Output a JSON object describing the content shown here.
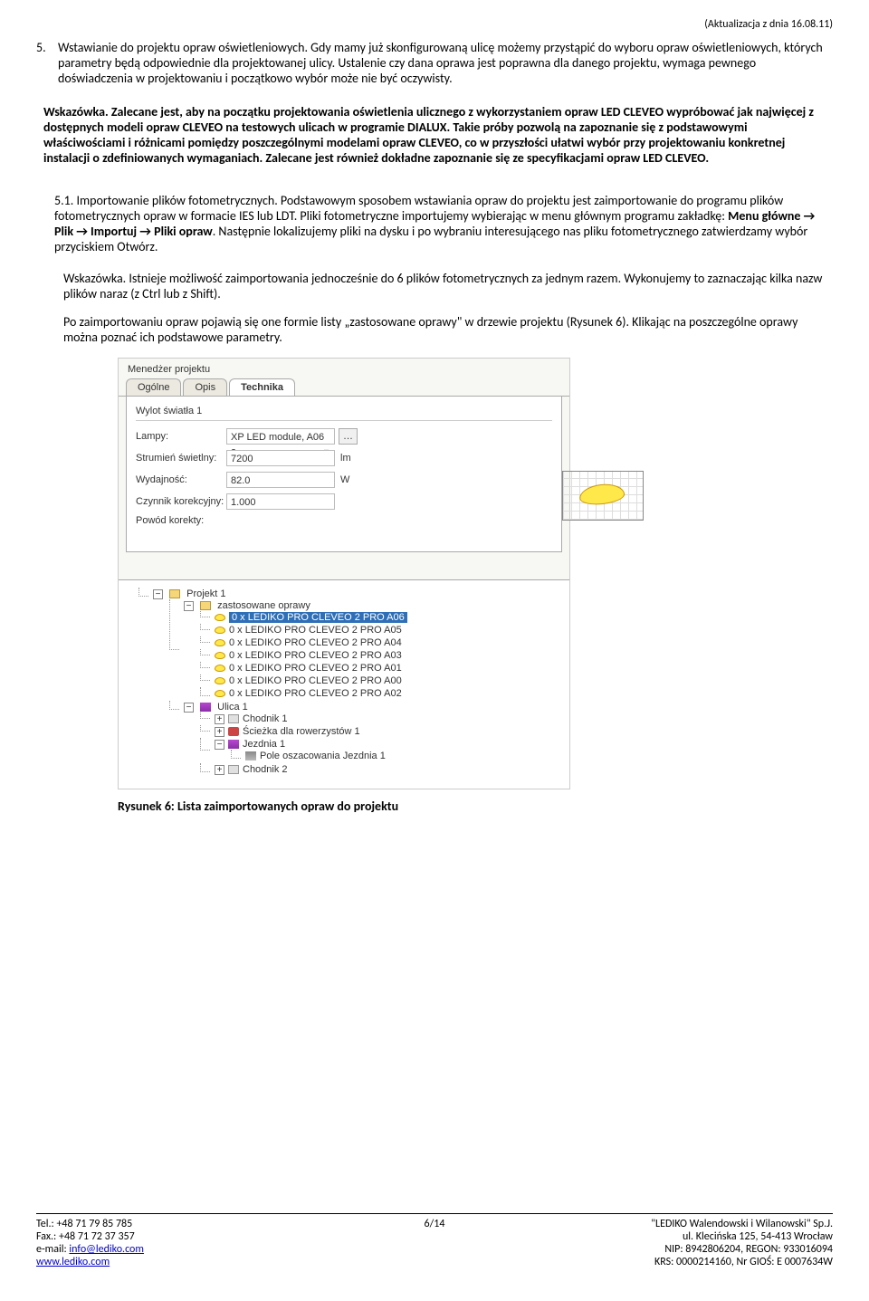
{
  "header_update": "(Aktualizacja z dnia  16.08.11)",
  "section5_num": "5.",
  "section5_text": "Wstawianie do projektu opraw oświetleniowych. Gdy mamy już skonfigurowaną ulicę możemy przystąpić do wyboru opraw oświetleniowych, których parametry będą odpowiednie dla projektowanej ulicy. Ustalenie czy dana oprawa jest poprawna dla danego projektu, wymaga pewnego doświadczenia w projektowaniu i początkowo wybór może nie być oczywisty.",
  "hint_text": "Wskazówka. Zalecane jest, aby na początku projektowania oświetlenia ulicznego z wykorzystaniem opraw LED CLEVEO wypróbować jak najwięcej z dostępnych modeli opraw CLEVEO na testowych ulicach w programie DIALUX. Takie próby pozwolą na zapoznanie się z podstawowymi właściwościami i różnicami pomiędzy poszczególnymi modelami opraw CLEVEO, co w przyszłości ułatwi wybór przy projektowaniu konkretnej instalacji o zdefiniowanych wymaganiach. Zalecane jest również dokładne zapoznanie się ze specyfikacjami opraw LED CLEVEO.",
  "sub51_num": "5.1.",
  "sub51_para1a": "Importowanie plików fotometrycznych. Podstawowym sposobem wstawiania opraw do projektu jest zaimportowanie do programu plików fotometrycznych opraw w formacie IES lub LDT. Pliki fotometryczne importujemy wybierając w menu głównym programu zakładkę: ",
  "sub51_menu": "Menu główne →  Plik → Importuj → Pliki opraw",
  "sub51_para1b": ". Następnie lokalizujemy pliki na dysku i po wybraniu interesującego nas pliku fotometrycznego zatwierdzamy wybór przyciskiem Otwórz.",
  "sub51_para2": "Wskazówka.  Istnieje możliwość zaimportowania jednocześnie do 6 plików fotometrycznych za jednym razem. Wykonujemy to zaznaczając kilka nazw plików naraz (z Ctrl lub z Shift).",
  "sub51_para3": "Po zaimportowaniu opraw pojawią się one formie listy „zastosowane oprawy\" w drzewie projektu (Rysunek 6). Klikając na poszczególne oprawy można poznać ich podstawowe parametry.",
  "screenshot": {
    "pm_title": "Menedżer projektu",
    "tabs": [
      "Ogólne",
      "Opis",
      "Technika"
    ],
    "active_tab": 2,
    "group_title": "Wylot światła 1",
    "rows": {
      "lamp_label": "Lampy:",
      "lamp_value": "XP LED module, A06 a",
      "flux_label": "Strumień świetlny:",
      "flux_value": "7200",
      "flux_unit": "lm",
      "power_label": "Wydajność:",
      "power_value": "82.0",
      "power_unit": "W",
      "factor_label": "Czynnik korekcyjny:",
      "factor_value": "1.000",
      "reason_label": "Powód korekty:"
    },
    "tree": {
      "root": "Projekt 1",
      "used": "zastosowane oprawy",
      "lamps": [
        "0 x LEDIKO PRO  CLEVEO 2 PRO A06",
        "0 x LEDIKO PRO  CLEVEO 2 PRO A05",
        "0 x LEDIKO PRO  CLEVEO 2 PRO A04",
        "0 x LEDIKO PRO  CLEVEO 2 PRO A03",
        "0 x LEDIKO PRO  CLEVEO 2 PRO A01",
        "0 x LEDIKO PRO  CLEVEO 2 PRO A00",
        "0 x LEDIKO PRO  CLEVEO 2 PRO A02"
      ],
      "selected_lamp": 0,
      "street": "Ulica 1",
      "sidewalk1": "Chodnik 1",
      "bikepath": "Ścieżka dla rowerzystów 1",
      "roadway": "Jezdnia 1",
      "pole": "Pole oszacowania Jezdnia 1",
      "sidewalk2": "Chodnik 2"
    }
  },
  "caption": "Rysunek 6: Lista zaimportowanych opraw do projektu",
  "footer": {
    "tel": "Tel.: +48 71 79 85 785",
    "fax": "Fax.: +48 71 72 37 357",
    "email_label": "e-mail: ",
    "email": "info@lediko.com",
    "web": "www.lediko.com",
    "page": "6/14",
    "company": "\"LEDIKO Walendowski i Wilanowski\" Sp.J.",
    "addr": "ul. Klecińska 125, 54-413 Wrocław",
    "nip": "NIP: 8942806204, REGON: 933016094",
    "krs": "KRS: 0000214160, Nr GIOŚ: E 0007634W"
  }
}
